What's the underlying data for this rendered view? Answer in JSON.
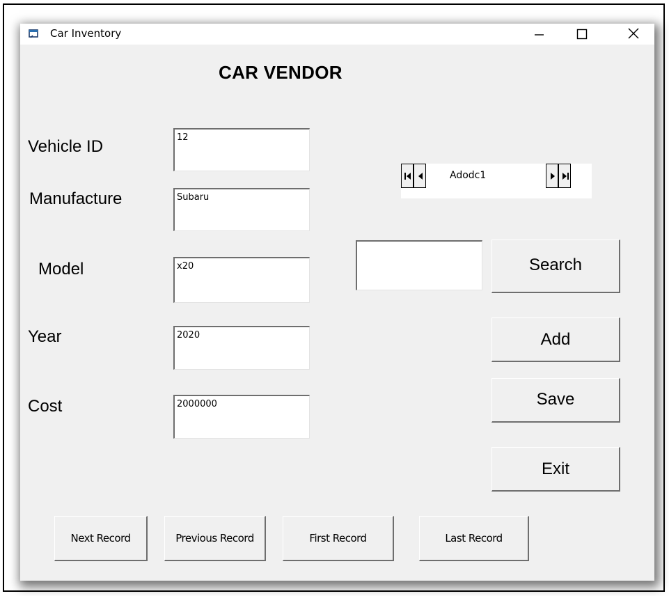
{
  "window": {
    "title": "Car Inventory",
    "minimize_glyph": "—",
    "maximize_glyph": "☐",
    "close_glyph": "✕"
  },
  "heading": "CAR VENDOR",
  "fields": {
    "vehicle_id": {
      "label": "Vehicle ID",
      "value": "12"
    },
    "manufacture": {
      "label": "Manufacture",
      "value": "Subaru"
    },
    "model": {
      "label": "Model",
      "value": "x20"
    },
    "year": {
      "label": "Year",
      "value": "2020"
    },
    "cost": {
      "label": "Cost",
      "value": "2000000"
    }
  },
  "adodc": {
    "caption": "Adodc1"
  },
  "search": {
    "value": "",
    "button_label": "Search"
  },
  "buttons": {
    "add": "Add",
    "save": "Save",
    "exit": "Exit",
    "next_record": "Next Record",
    "previous_record": "Previous Record",
    "first_record": "First Record",
    "last_record": "Last Record"
  },
  "icons": {
    "app": "app-window-icon",
    "first": "first-record-icon",
    "prev": "prev-record-icon",
    "next": "next-record-icon",
    "last": "last-record-icon"
  }
}
